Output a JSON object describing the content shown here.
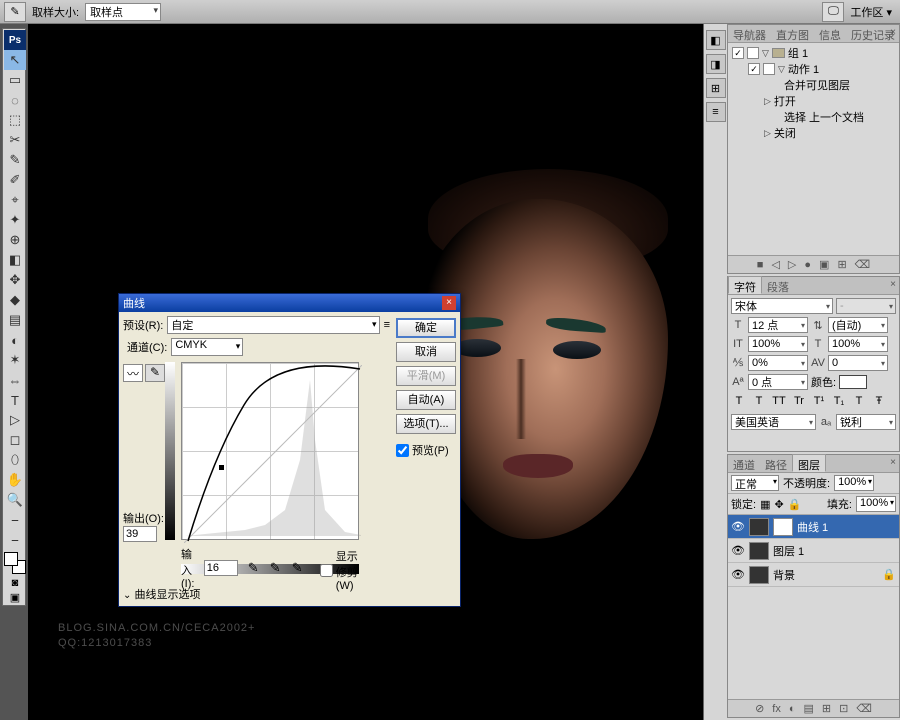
{
  "options_bar": {
    "sample_size_label": "取样大小:",
    "sample_size_value": "取样点",
    "workspace_label": "工作区 ▾"
  },
  "tools": [
    "↖",
    "▭",
    "◌",
    "⬚",
    "✂",
    "✎",
    "✐",
    "⌖",
    "✦",
    "⊕",
    "◧",
    "✥",
    "◆",
    "▤",
    "◐",
    "✶",
    "⇔",
    "T",
    "▷",
    "◻",
    "⬯",
    "✋",
    "🔍",
    "⎯",
    "⎯"
  ],
  "history": {
    "tabs": [
      "导航器",
      "直方图",
      "信息",
      "历史记录",
      "动作"
    ],
    "active_tab": 4,
    "root": "组 1",
    "action_set": "动作 1",
    "items": [
      "合并可见图层",
      "打开",
      "选择 上一个文档",
      "关闭"
    ],
    "footer_icons": [
      "■",
      "◁",
      "▷",
      "●",
      "▣",
      "⊞",
      "⌫"
    ]
  },
  "character": {
    "tabs": [
      "字符",
      "段落"
    ],
    "active_tab": 0,
    "font_family": "宋体",
    "font_style": "-",
    "font_size": "12 点",
    "leading": "(自动)",
    "tracking_v": "100%",
    "tracking_h": "100%",
    "kerning": "0%",
    "baseline": "0",
    "shift": "0 点",
    "color_label": "颜色:",
    "style_btns": [
      "T",
      "T",
      "TT",
      "Tr",
      "T¹",
      "T₁",
      "T",
      "Ŧ"
    ],
    "lang": "美国英语",
    "aa": "锐利"
  },
  "layers": {
    "tabs": [
      "通道",
      "路径",
      "图层"
    ],
    "active_tab": 2,
    "blend_mode": "正常",
    "opacity_label": "不透明度:",
    "opacity": "100%",
    "lock_label": "锁定:",
    "fill_label": "填充:",
    "fill": "100%",
    "items": [
      {
        "name": "曲线 1",
        "sel": true,
        "thumbs": 2
      },
      {
        "name": "图层 1",
        "sel": false,
        "thumbs": 1
      },
      {
        "name": "背景",
        "sel": false,
        "thumbs": 1,
        "lock": true
      }
    ],
    "footer_icons": [
      "⊘",
      "fx",
      "◐",
      "▤",
      "⊞",
      "⊡",
      "⌫"
    ]
  },
  "dialog": {
    "title": "曲线",
    "preset_label": "预设(R):",
    "preset_value": "自定",
    "channel_label": "通道(C):",
    "channel_value": "CMYK",
    "output_label": "输出(O):",
    "output_value": "39",
    "input_label": "输入(I):",
    "input_value": "16",
    "show_clip_label": "显示修剪(W)",
    "disclosure_label": "曲线显示选项",
    "buttons": {
      "ok": "确定",
      "cancel": "取消",
      "smooth": "平滑(M)",
      "auto": "自动(A)",
      "options": "选项(T)..."
    },
    "preview_label": "预览(P)"
  },
  "watermark": {
    "line1": "BLOG.SINA.COM.CN/CECA2002+",
    "line2": "QQ:1213017383"
  }
}
